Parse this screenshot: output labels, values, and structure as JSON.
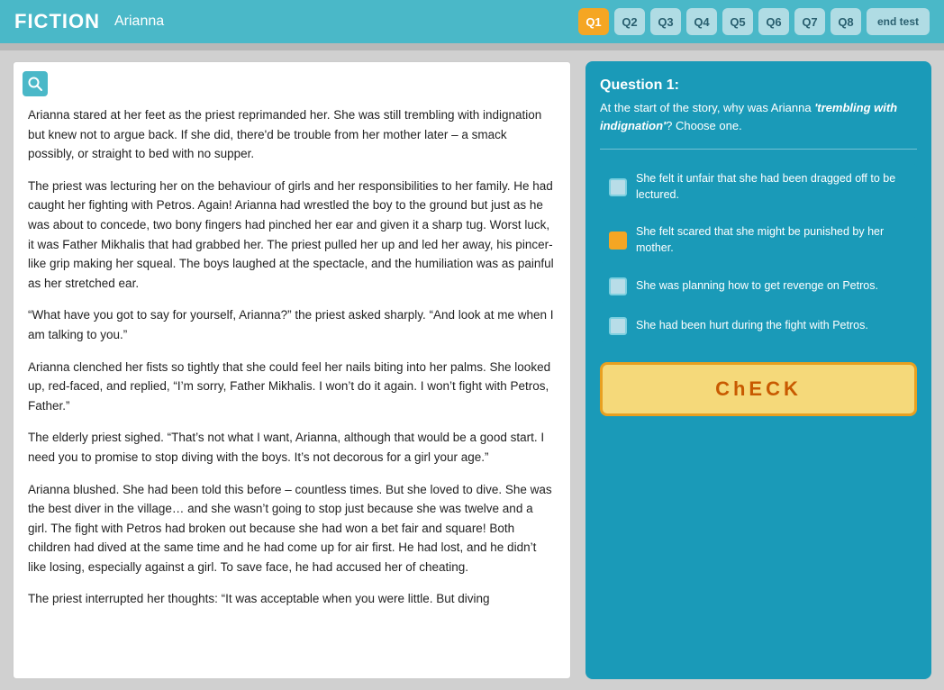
{
  "header": {
    "title": "FICTION",
    "subtitle": "Arianna",
    "nav_buttons": [
      "Q1",
      "Q2",
      "Q3",
      "Q4",
      "Q5",
      "Q6",
      "Q7",
      "Q8"
    ],
    "active_button": "Q1",
    "end_test_label": "end test"
  },
  "passage": {
    "paragraphs": [
      "Arianna stared at her feet as the priest reprimanded her. She was still trembling with indignation but knew not to argue back. If she did, there'd be trouble from her mother later – a smack possibly, or straight to bed with no supper.",
      "The priest was lecturing her on the behaviour of girls and her responsibilities to her family. He had caught her fighting with Petros. Again! Arianna had wrestled the boy to the ground but just as he was about to concede, two bony fingers had pinched her ear and given it a sharp tug. Worst luck, it was Father Mikhalis that had grabbed her. The priest pulled her up and led her away, his pincer-like grip making her squeal. The boys laughed at the spectacle, and the humiliation was as painful as her stretched ear.",
      "“What have you got to say for yourself, Arianna?” the priest asked sharply. “And look at me when I am talking to you.”",
      "Arianna clenched her fists so tightly that she could feel her nails biting into her palms. She looked up, red-faced, and replied, “I’m sorry, Father Mikhalis. I won’t do it again. I won’t fight with Petros, Father.”",
      "The elderly priest sighed. “That’s not what I want, Arianna, although that would be a good start. I need you to promise to stop diving with the boys. It’s not decorous for a girl your age.”",
      "Arianna blushed. She had been told this before – countless times. But she loved to dive. She was the best diver in the village… and she wasn’t going to stop just because she was twelve and a girl. The fight with Petros had broken out because she had won a bet fair and square! Both children had dived at the same time and he had come up for air first. He had lost, and he didn’t like losing, especially against a girl. To save face, he had accused her of cheating.",
      "The priest interrupted her thoughts: “It was acceptable when you were little. But diving"
    ]
  },
  "question": {
    "title": "Question 1:",
    "text": "At the start of the story, why was Arianna ",
    "text_italic": "'trembling with indignation'",
    "text_suffix": "? Choose one.",
    "options": [
      {
        "id": "opt1",
        "label": "She felt it unfair that she had been dragged off to be lectured.",
        "selected": false
      },
      {
        "id": "opt2",
        "label": "She felt scared that she might be punished by her mother.",
        "selected": true
      },
      {
        "id": "opt3",
        "label": "She was planning how to get revenge on Petros.",
        "selected": false
      },
      {
        "id": "opt4",
        "label": "She had been hurt during the fight with Petros.",
        "selected": false
      }
    ],
    "check_label": "ChECK"
  }
}
